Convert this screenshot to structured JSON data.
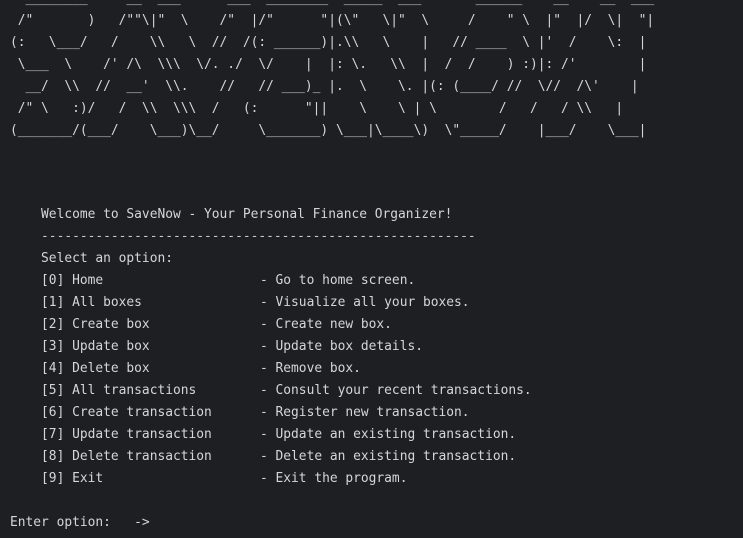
{
  "banner": {
    "ascii_lines": [
      "  ________     __  ___      ___  ________  _____  ___       ______    __    __  ___",
      " /\"       )   /\"\"\\|\"  \\    /\"  |/\"      \"|(\\\"   \\|\"  \\     /    \" \\  |\"  |/  \\|  \"|",
      "(:   \\___/   /    \\\\   \\  //  /(: ______)|.\\\\   \\    |   // ____  \\ |'  /    \\:  |",
      " \\___  \\    /' /\\  \\\\\\  \\/. ./  \\/    |  |: \\.   \\\\  |  /  /    ) :)|: /'        |",
      "  __/  \\\\  //  __'  \\\\.    //   // ___)_ |.  \\    \\. |(: (____/ //  \\//  /\\'    |",
      " /\" \\   :)/   /  \\\\  \\\\\\  /   (:      \"||    \\    \\ | \\        /   /   / \\\\   |",
      "(_______/(___/    \\___)\\__/     \\_______) \\___|\\____\\)  \\\"_____/    |___/    \\___|"
    ]
  },
  "welcome_text": "    Welcome to SaveNow - Your Personal Finance Organizer!",
  "divider_text": "    --------------------------------------------------------",
  "select_prompt": "    Select an option:",
  "menu": [
    {
      "key": "    [0] Home",
      "desc": "- Go to home screen."
    },
    {
      "key": "    [1] All boxes",
      "desc": "- Visualize all your boxes."
    },
    {
      "key": "    [2] Create box",
      "desc": "- Create new box."
    },
    {
      "key": "    [3] Update box",
      "desc": "- Update box details."
    },
    {
      "key": "    [4] Delete box",
      "desc": "- Remove box."
    },
    {
      "key": "    [5] All transactions",
      "desc": "- Consult your recent transactions."
    },
    {
      "key": "    [6] Create transaction",
      "desc": "- Register new transaction."
    },
    {
      "key": "    [7] Update transaction",
      "desc": "- Update an existing transaction."
    },
    {
      "key": "    [8] Delete transaction",
      "desc": "- Delete an existing transaction."
    },
    {
      "key": "    [9] Exit",
      "desc": "- Exit the program."
    }
  ],
  "enter_prompt": "Enter option:   ->",
  "input_value": "",
  "colors": {
    "background": "#1e1f22",
    "foreground": "#d4d6da"
  }
}
